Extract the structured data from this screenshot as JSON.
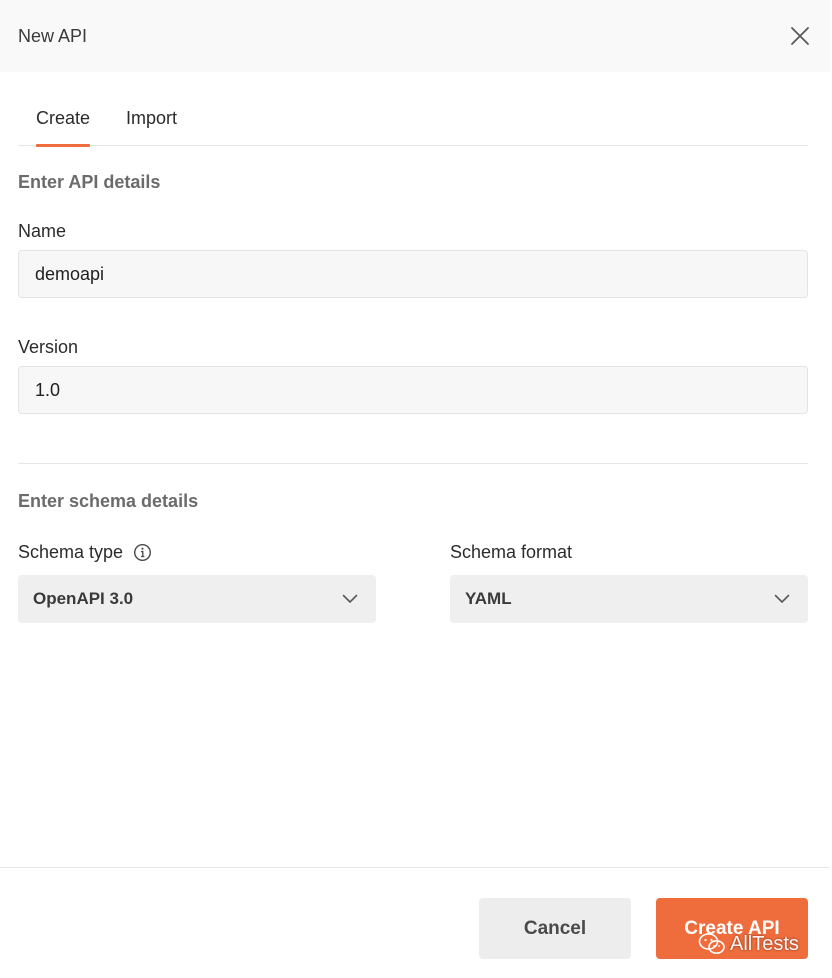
{
  "dialog": {
    "title": "New API",
    "close_icon": "close-icon"
  },
  "tabs": [
    {
      "label": "Create",
      "active": true
    },
    {
      "label": "Import",
      "active": false
    }
  ],
  "api_details": {
    "section_title": "Enter API details",
    "name_label": "Name",
    "name_value": "demoapi",
    "version_label": "Version",
    "version_value": "1.0"
  },
  "schema_details": {
    "section_title": "Enter schema details",
    "type_label": "Schema type",
    "type_info_icon": "info-icon",
    "type_value": "OpenAPI 3.0",
    "format_label": "Schema format",
    "format_value": "YAML",
    "dropdown_icon": "chevron-down-icon"
  },
  "footer": {
    "cancel_label": "Cancel",
    "create_label": "Create API"
  },
  "watermark": {
    "text": "AllTests",
    "icon": "wechat-icon"
  },
  "colors": {
    "accent": "#ef6c3c",
    "header_bg": "#f9f9f9",
    "input_bg": "#f7f7f7",
    "select_bg": "#efefef"
  }
}
